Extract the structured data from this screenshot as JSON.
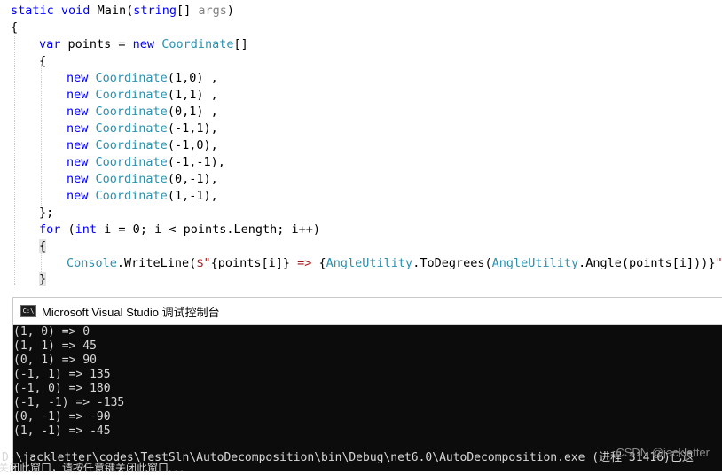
{
  "editor": {
    "lines": {
      "l1": {
        "kw_static": "static",
        "kw_void": "void",
        "name": "Main",
        "paren_open": "(",
        "kw_string": "string",
        "brackets": "[] ",
        "param": "args",
        "paren_close": ")"
      },
      "l2": {
        "text": "{"
      },
      "l3": {
        "kw_var": "var",
        "mid": " points = ",
        "kw_new": "new",
        "space": " ",
        "type": "Coordinate",
        "tail": "[]"
      },
      "l4": {
        "text": "{"
      },
      "items": [
        {
          "kw": "new",
          "type": "Coordinate",
          "args": "(1,0) ,"
        },
        {
          "kw": "new",
          "type": "Coordinate",
          "args": "(1,1) ,"
        },
        {
          "kw": "new",
          "type": "Coordinate",
          "args": "(0,1) ,"
        },
        {
          "kw": "new",
          "type": "Coordinate",
          "args": "(-1,1),"
        },
        {
          "kw": "new",
          "type": "Coordinate",
          "args": "(-1,0),"
        },
        {
          "kw": "new",
          "type": "Coordinate",
          "args": "(-1,-1),"
        },
        {
          "kw": "new",
          "type": "Coordinate",
          "args": "(0,-1),"
        },
        {
          "kw": "new",
          "type": "Coordinate",
          "args": "(1,-1),"
        }
      ],
      "l13": {
        "text": "};"
      },
      "l14": {
        "kw_for": "for",
        "p1": " (",
        "kw_int": "int",
        "p2": " i = 0; i < points.Length; i++)"
      },
      "l15": {
        "text": "{"
      },
      "l16": {
        "type_console": "Console",
        "dot1": ".WriteLine(",
        "str_open": "$\"",
        "interp1": "{points[i]}",
        "str_arrow": " => ",
        "interp_open": "{",
        "type_angle1": "AngleUtility",
        "call1": ".ToDegrees(",
        "type_angle2": "AngleUtility",
        "call2": ".Angle(points[i]))}",
        "str_close": "\")"
      },
      "l17": {
        "text": "}"
      }
    }
  },
  "console": {
    "icon_label": "C:\\",
    "title": "Microsoft Visual Studio 调试控制台",
    "output": [
      "(1, 0) => 0",
      "(1, 1) => 45",
      "(0, 1) => 90",
      "(-1, 1) => 135",
      "(-1, 0) => 180",
      "(-1, -1) => -135",
      "(0, -1) => -90",
      "(1, -1) => -45"
    ],
    "exit_line": "D:\\jackletter\\codes\\TestSln\\AutoDecomposition\\bin\\Debug\\net6.0\\AutoDecomposition.exe (进程 31416)已退",
    "close_hint": "关闭此窗口，请按任意键关闭此窗口. . ."
  },
  "watermark": "CSDN @jackletter",
  "colors": {
    "keyword": "#0000ff",
    "type": "#2b91af",
    "string": "#a31515",
    "console_bg": "#0c0c0c",
    "console_text": "#d8d8d8"
  }
}
